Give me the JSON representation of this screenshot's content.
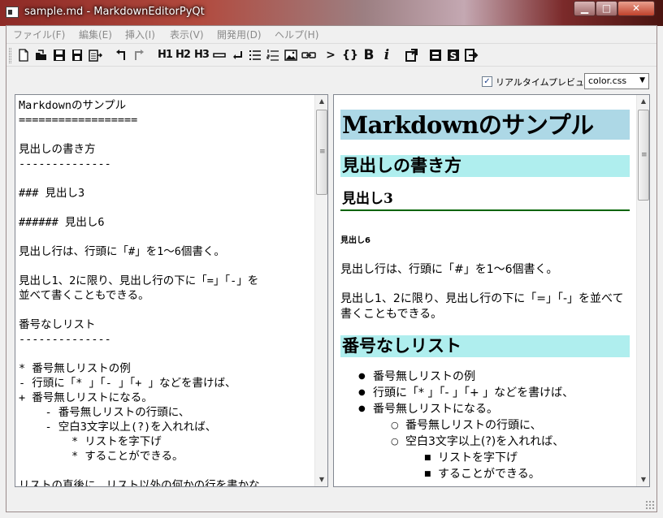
{
  "window": {
    "title": "sample.md - MarkdownEditorPyQt",
    "min_glyph": "▁",
    "max_glyph": "□",
    "close_glyph": "✕"
  },
  "menubar": [
    "ファイル(F)",
    "編集(E)",
    "挿入(I)",
    "表示(V)",
    "開発用(D)",
    "ヘルプ(H)"
  ],
  "toolbar": {
    "h1": "H1",
    "h2": "H2",
    "h3": "H3",
    "code": "{}",
    "bold": "B",
    "italic": "i",
    "quote": ">"
  },
  "options": {
    "realtime_preview_label": "リアルタイムプレビュー",
    "realtime_preview_checked": "✓",
    "css_select_value": "color.css"
  },
  "editor": {
    "text": "Markdownのサンプル\n==================\n\n見出しの書き方\n--------------\n\n### 見出し3\n\n###### 見出し6\n\n見出し行は、行頭に「#」を1～6個書く。\n\n見出し1、2に限り、見出し行の下に「=」「-」を\n並べて書くこともできる。\n\n番号なしリスト\n--------------\n\n* 番号無しリストの例\n- 行頭に「* 」「- 」「+ 」などを書けば、\n+ 番号無しリストになる。\n    - 番号無しリストの行頭に、\n    - 空白3文字以上(?)を入れれば、\n        * リストを字下げ\n        * することができる。\n\nリストの直後に、リスト以外の何かの行を書かな"
  },
  "preview": {
    "h1": "Markdownのサンプル",
    "h2_headings": "見出しの書き方",
    "h3": "見出し3",
    "h6": "見出し6",
    "p1": "見出し行は、行頭に「#」を1～6個書く。",
    "p2": "見出し1、2に限り、見出し行の下に「=」「-」を並べて書くこともできる。",
    "h2_list": "番号なしリスト",
    "list": [
      "番号無しリストの例",
      "行頭に「* 」「- 」「+ 」などを書けば、",
      "番号無しリストになる。",
      "番号無しリストの行頭に、",
      "空白3文字以上(?)を入れれば、",
      "リストを字下げ",
      "することができる。"
    ]
  },
  "colors": {
    "h1_bg": "#add8e6",
    "h2_bg": "#afeeee",
    "h3_border": "#006400"
  }
}
